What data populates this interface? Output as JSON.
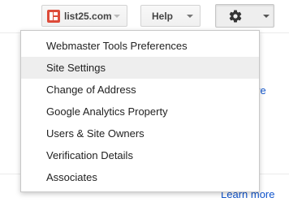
{
  "toolbar": {
    "site_label": "list25.com",
    "help_label": "Help"
  },
  "menu": {
    "items": [
      {
        "label": "Webmaster Tools Preferences",
        "highlighted": false
      },
      {
        "label": "Site Settings",
        "highlighted": true
      },
      {
        "label": "Change of Address",
        "highlighted": false
      },
      {
        "label": "Google Analytics Property",
        "highlighted": false
      },
      {
        "label": "Users & Site Owners",
        "highlighted": false
      },
      {
        "label": "Verification Details",
        "highlighted": false
      },
      {
        "label": "Associates",
        "highlighted": false
      }
    ]
  },
  "background": {
    "link_1": "ore",
    "link_2": "Learn more"
  },
  "colors": {
    "link": "#1155cc",
    "logo": "#dd4b39",
    "hover": "#eeeeee"
  },
  "icons": {
    "site_logo": "list25-logo-icon",
    "settings": "gear-icon"
  }
}
